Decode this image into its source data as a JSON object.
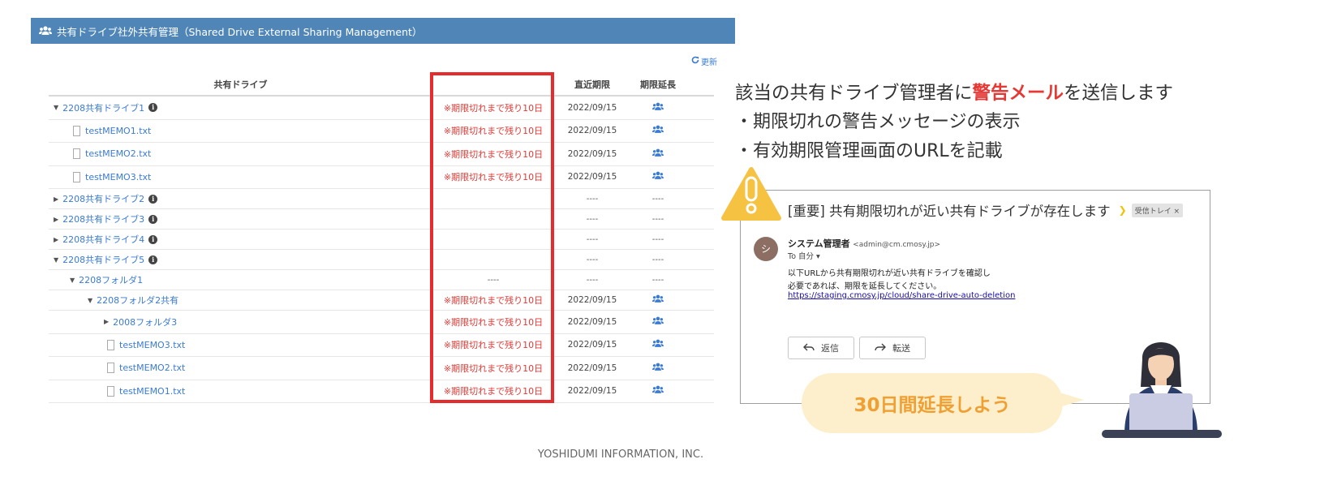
{
  "panel": {
    "title": "共有ドライブ社外共有管理（Shared Drive External Sharing Management）",
    "refresh_label": "更新",
    "columns": {
      "drive": "共有ドライブ",
      "deadline": "直近期限",
      "extend": "期限延長"
    },
    "rows": [
      {
        "type": "drive",
        "expanded": true,
        "name": "2208共有ドライブ1",
        "info": "i",
        "warning": "※期限切れまで残り10日",
        "deadline": "2022/09/15",
        "extend": true
      },
      {
        "type": "file",
        "name": "testMEMO1.txt",
        "warning": "※期限切れまで残り10日",
        "deadline": "2022/09/15",
        "extend": true
      },
      {
        "type": "file",
        "name": "testMEMO2.txt",
        "warning": "※期限切れまで残り10日",
        "deadline": "2022/09/15",
        "extend": true
      },
      {
        "type": "file",
        "name": "testMEMO3.txt",
        "warning": "※期限切れまで残り10日",
        "deadline": "2022/09/15",
        "extend": true
      },
      {
        "type": "drive",
        "expanded": false,
        "name": "2208共有ドライブ2",
        "info": "i",
        "warning": "",
        "deadline": "----",
        "extend_text": "----"
      },
      {
        "type": "drive",
        "expanded": false,
        "name": "2208共有ドライブ3",
        "info": "i",
        "warning": "",
        "deadline": "----",
        "extend_text": "----"
      },
      {
        "type": "drive",
        "expanded": false,
        "name": "2208共有ドライブ4",
        "info": "i",
        "warning": "",
        "deadline": "----",
        "extend_text": "----"
      },
      {
        "type": "drive",
        "expanded": true,
        "name": "2208共有ドライブ5",
        "info": "i",
        "warning": "",
        "deadline": "----",
        "extend_text": "----"
      },
      {
        "type": "folder1",
        "expanded": true,
        "name": "2208フォルダ1",
        "warning": "----",
        "deadline": "----",
        "extend_text": "----"
      },
      {
        "type": "folder2",
        "expanded": true,
        "name": "2208フォルダ2共有",
        "warning": "※期限切れまで残り10日",
        "deadline": "2022/09/15",
        "extend": true
      },
      {
        "type": "folder3",
        "expanded": false,
        "name": "2008フォルダ3",
        "warning": "※期限切れまで残り10日",
        "deadline": "2022/09/15",
        "extend": true
      },
      {
        "type": "subfile",
        "name": "testMEMO3.txt",
        "warning": "※期限切れまで残り10日",
        "deadline": "2022/09/15",
        "extend": true
      },
      {
        "type": "subfile",
        "name": "testMEMO2.txt",
        "warning": "※期限切れまで残り10日",
        "deadline": "2022/09/15",
        "extend": true
      },
      {
        "type": "subfile",
        "name": "testMEMO1.txt",
        "warning": "※期限切れまで残り10日",
        "deadline": "2022/09/15",
        "extend": true
      }
    ]
  },
  "explain": {
    "heading_pre": "該当の共有ドライブ管理者に",
    "heading_highlight": "警告メール",
    "heading_post": "を送信します",
    "bullet1": "・期限切れの警告メッセージの表示",
    "bullet2": "・有効期限管理画面のURLを記載"
  },
  "mail": {
    "subject": "[重要] 共有期限切れが近い共有ドライブが存在します",
    "inbox_label": "受信トレイ ×",
    "avatar_letter": "シ",
    "sender_name": "システム管理者",
    "sender_addr": "<admin@cm.cmosy.jp>",
    "to": "To 自分 ▾",
    "body1": "以下URLから共有期限切れが近い共有ドライブを確認し",
    "body2": "必要であれば、期限を延長してください。",
    "link": "https://staging.cmosy.jp/cloud/share-drive-auto-deletion",
    "reply_label": "返信",
    "forward_label": "転送"
  },
  "bubble": {
    "text": "30日間延長しよう"
  },
  "footer": {
    "text": "YOSHIDUMI INFORMATION, INC."
  },
  "colors": {
    "header_bg": "#4f86b7",
    "link_blue": "#3a7bd5",
    "warning_red": "#e53935",
    "bubble_bg": "#fdefcc",
    "bubble_text": "#f0a033",
    "warning_yellow": "#f5c242"
  },
  "icons": {
    "header": "users-icon",
    "extend": "users-icon",
    "refresh": "refresh-icon",
    "warning": "warning-icon"
  }
}
